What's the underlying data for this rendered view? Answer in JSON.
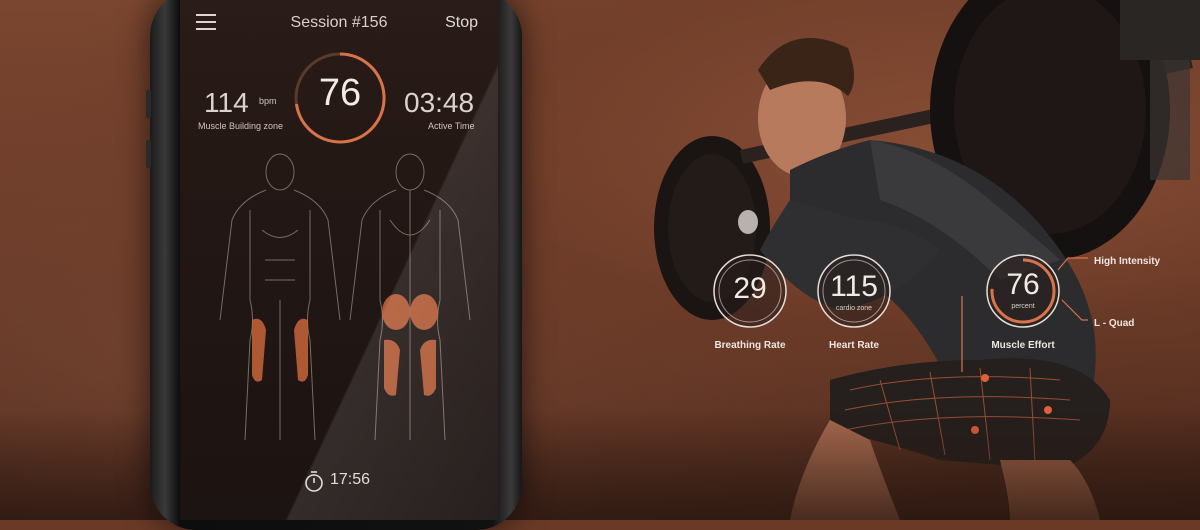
{
  "phone": {
    "session_title": "Session #156",
    "stop_label": "Stop",
    "score": "76",
    "heart_rate": {
      "value": "114",
      "unit": "bpm",
      "zone": "Muscle Building zone"
    },
    "active_time": {
      "value": "03:48",
      "label": "Active Time"
    },
    "timer": "17:56",
    "highlight_color": "#c8643a"
  },
  "overlay": {
    "breathing": {
      "value": "29",
      "label": "Breathing Rate"
    },
    "heart": {
      "value": "115",
      "sub": "cardio zone",
      "label": "Heart Rate"
    },
    "effort": {
      "value": "76",
      "sub": "percent",
      "label": "Muscle Effort",
      "fraction": 0.76
    },
    "callouts": {
      "intensity": "High Intensity",
      "muscle": "L - Quad"
    }
  },
  "colors": {
    "accent": "#d9744a",
    "ring": "#e8ddd6"
  },
  "icons": [
    "menu-icon",
    "stopwatch-icon"
  ]
}
